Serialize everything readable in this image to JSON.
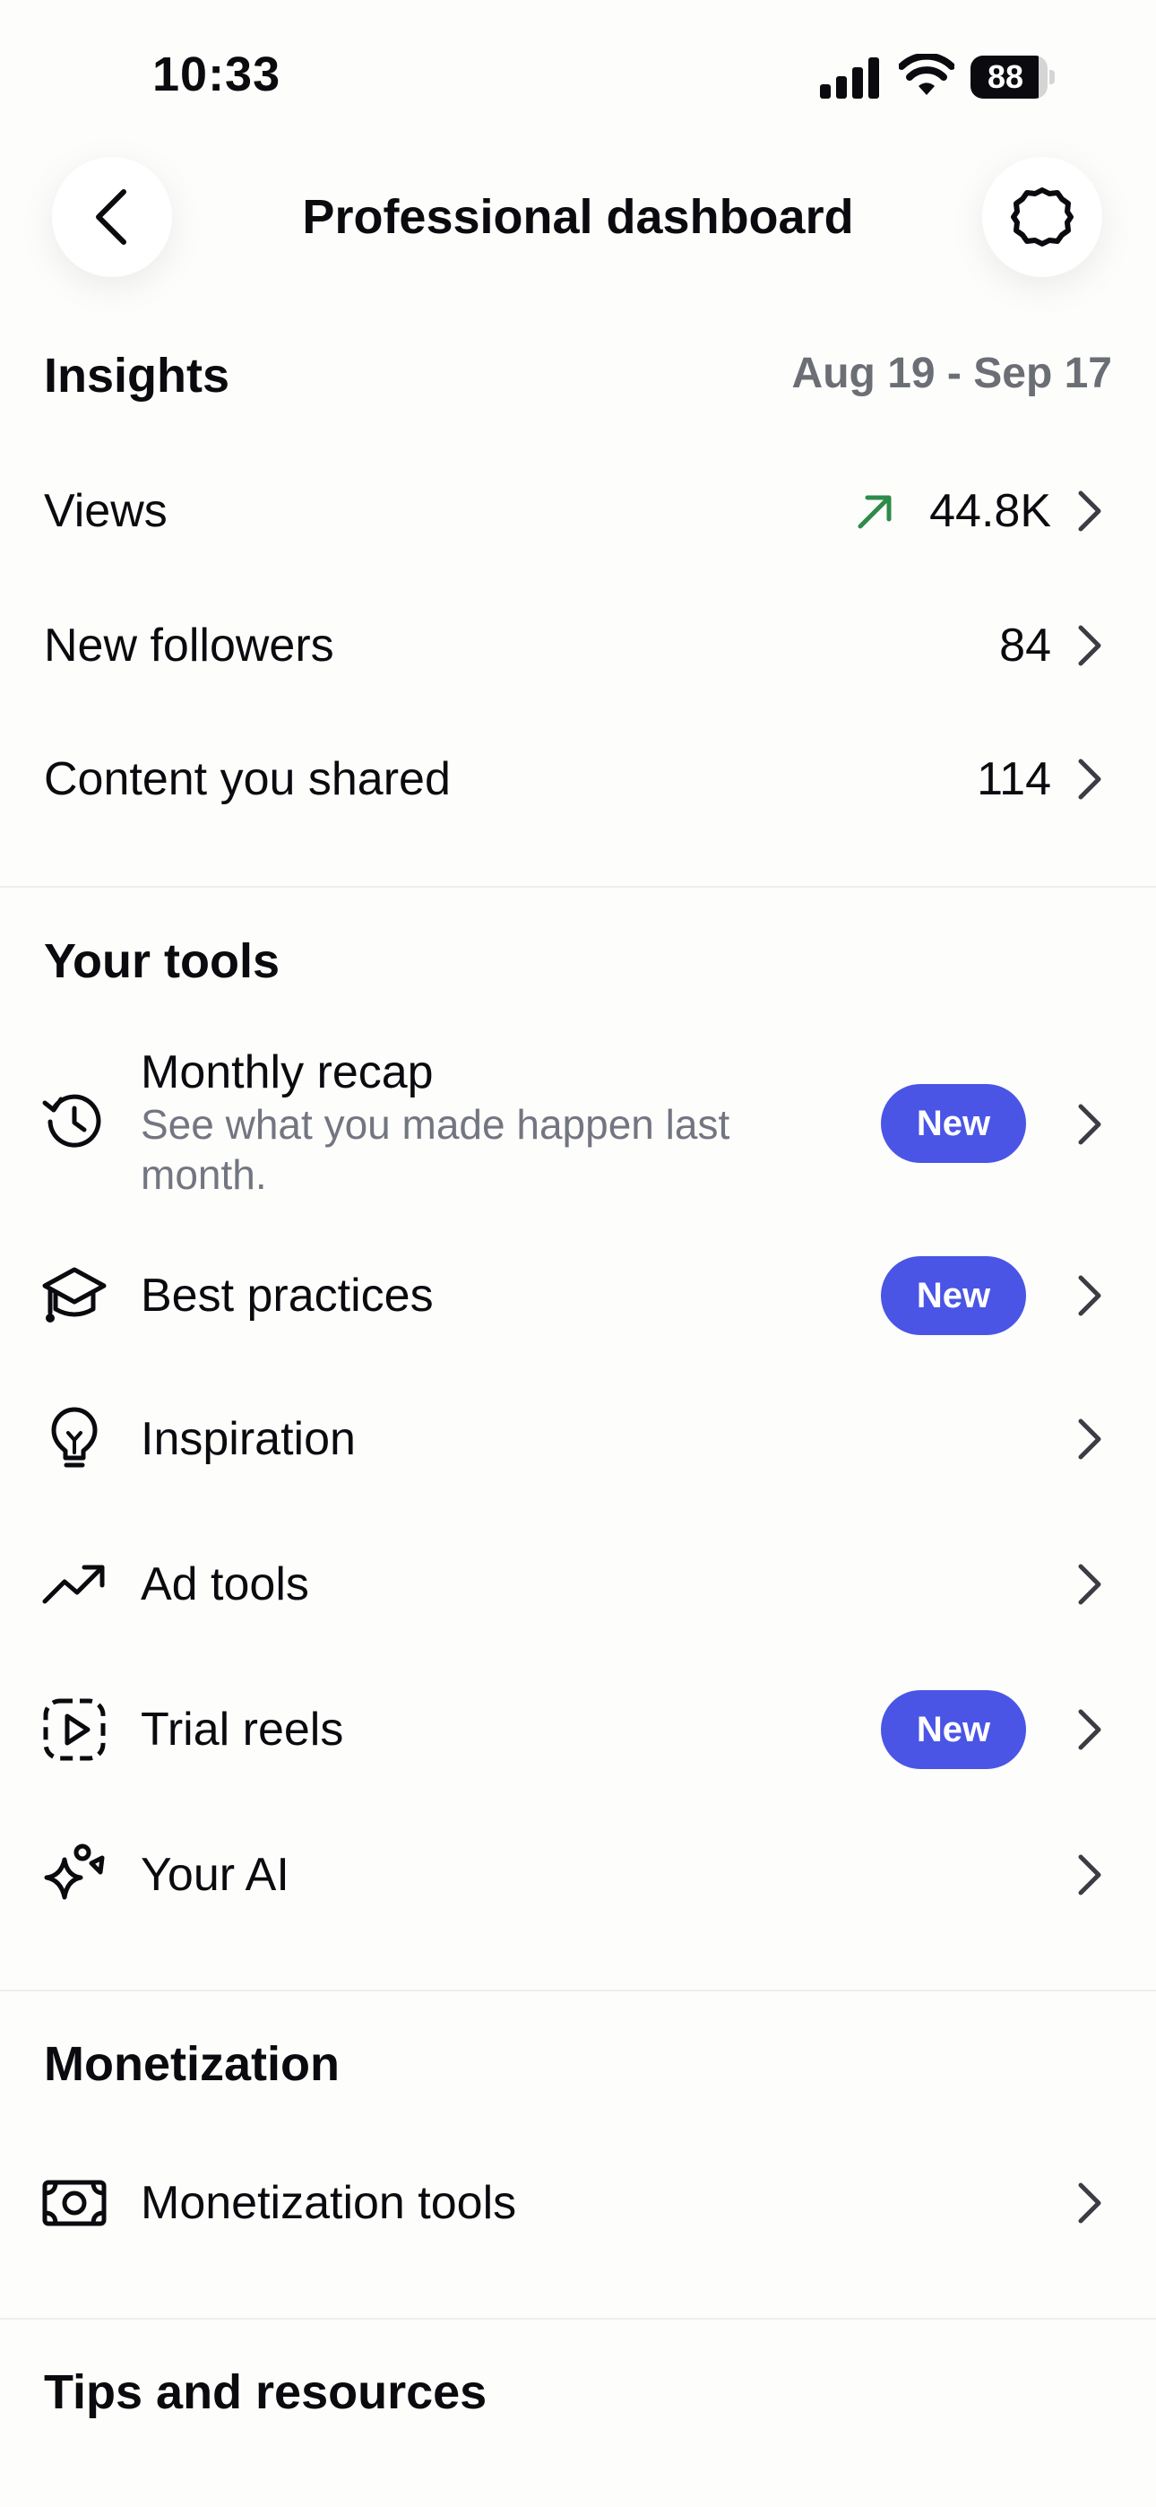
{
  "status_bar": {
    "time": "10:33",
    "battery_level": "88",
    "battery_fraction": 0.88,
    "icons": [
      "signal-icon",
      "wifi-icon",
      "battery-icon"
    ]
  },
  "nav": {
    "title": "Professional dashboard",
    "back_icon": "chevron-left-icon",
    "settings_icon": "gear-icon"
  },
  "insights": {
    "title": "Insights",
    "date_range": "Aug 19 - Sep 17",
    "rows": [
      {
        "label": "Views",
        "value": "44.8K",
        "trend": "up",
        "trend_color": "#2E8B4A"
      },
      {
        "label": "New followers",
        "value": "84"
      },
      {
        "label": "Content you shared",
        "value": "114"
      }
    ]
  },
  "tools": {
    "title": "Your tools",
    "items": [
      {
        "label": "Monthly recap",
        "sublabel": "See what you made happen last month.",
        "badge": "New",
        "icon": "history-icon"
      },
      {
        "label": "Best practices",
        "badge": "New",
        "icon": "graduation-cap-icon"
      },
      {
        "label": "Inspiration",
        "icon": "lightbulb-icon"
      },
      {
        "label": "Ad tools",
        "icon": "trending-up-icon"
      },
      {
        "label": "Trial reels",
        "badge": "New",
        "icon": "reel-play-icon"
      },
      {
        "label": "Your AI",
        "icon": "sparkle-icon"
      }
    ]
  },
  "monetization": {
    "title": "Monetization",
    "items": [
      {
        "label": "Monetization tools",
        "icon": "cash-icon"
      }
    ]
  },
  "tips": {
    "title": "Tips and resources"
  },
  "colors": {
    "accent": "#4A55E6",
    "trend_up": "#2E8B4A",
    "secondary_text": "#6B6E75",
    "background": "#FDFDFC"
  }
}
